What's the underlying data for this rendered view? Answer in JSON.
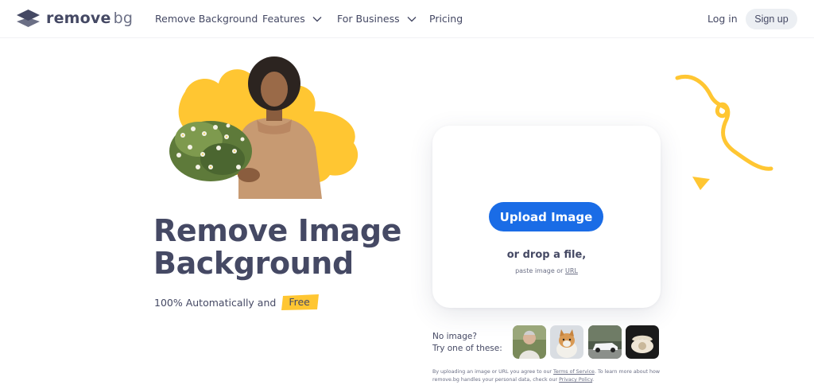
{
  "nav": {
    "brand_remove": "remove",
    "brand_bg": "bg",
    "items": [
      {
        "label": "Remove Background"
      },
      {
        "label": "Features"
      },
      {
        "label": "For Business"
      },
      {
        "label": "Pricing"
      }
    ],
    "login": "Log in",
    "signup": "Sign up"
  },
  "hero": {
    "line1": "Remove Image",
    "line2": "Background",
    "sub_text": "100% Automatically and",
    "free": "Free"
  },
  "upload": {
    "button": "Upload Image",
    "drop": "or drop a file,",
    "paste_prefix": "paste image or",
    "url": "URL"
  },
  "samples": {
    "line1": "No image?",
    "line2": "Try one of these:",
    "thumbs": [
      "woman-photo",
      "dog-photo",
      "car-photo",
      "phone-photo"
    ]
  },
  "legal": {
    "p1": "By uploading an image or URL you agree to our",
    "tos": "Terms of Service",
    "p2": ". To learn more about how remove.bg handles your personal data, check our",
    "privacy": "Privacy Policy",
    "p3": "."
  },
  "colors": {
    "accent_blue": "#1a6ce6",
    "yellow": "#ffc632",
    "text": "#454964"
  }
}
